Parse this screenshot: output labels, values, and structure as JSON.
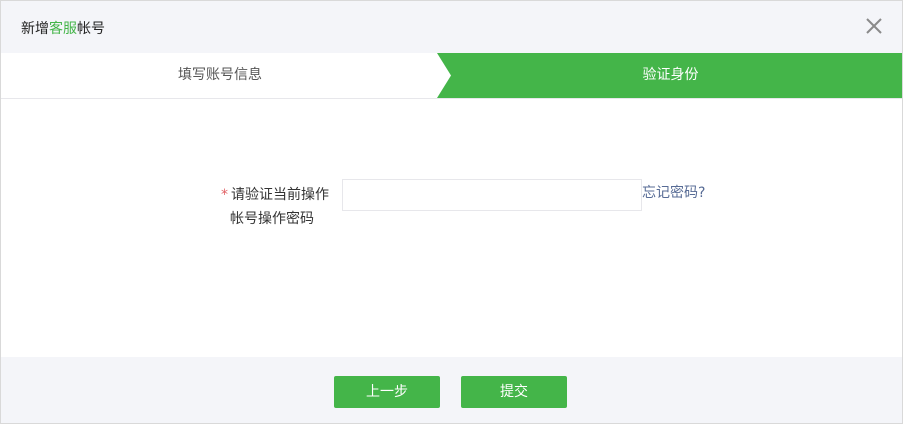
{
  "dialog": {
    "title_prefix": "新增",
    "title_accent": "客服",
    "title_suffix": "帐号"
  },
  "steps": [
    {
      "label": "填写账号信息",
      "active": false
    },
    {
      "label": "验证身份",
      "active": true
    }
  ],
  "form": {
    "required_mark": "*",
    "label_line1": "请验证当前操作",
    "label_line2": "帐号操作密码",
    "password_value": "",
    "forgot_link": "忘记密码?"
  },
  "footer": {
    "prev_label": "上一步",
    "submit_label": "提交"
  },
  "colors": {
    "accent": "#44b549",
    "link": "#576b95",
    "required": "#e15f63"
  }
}
